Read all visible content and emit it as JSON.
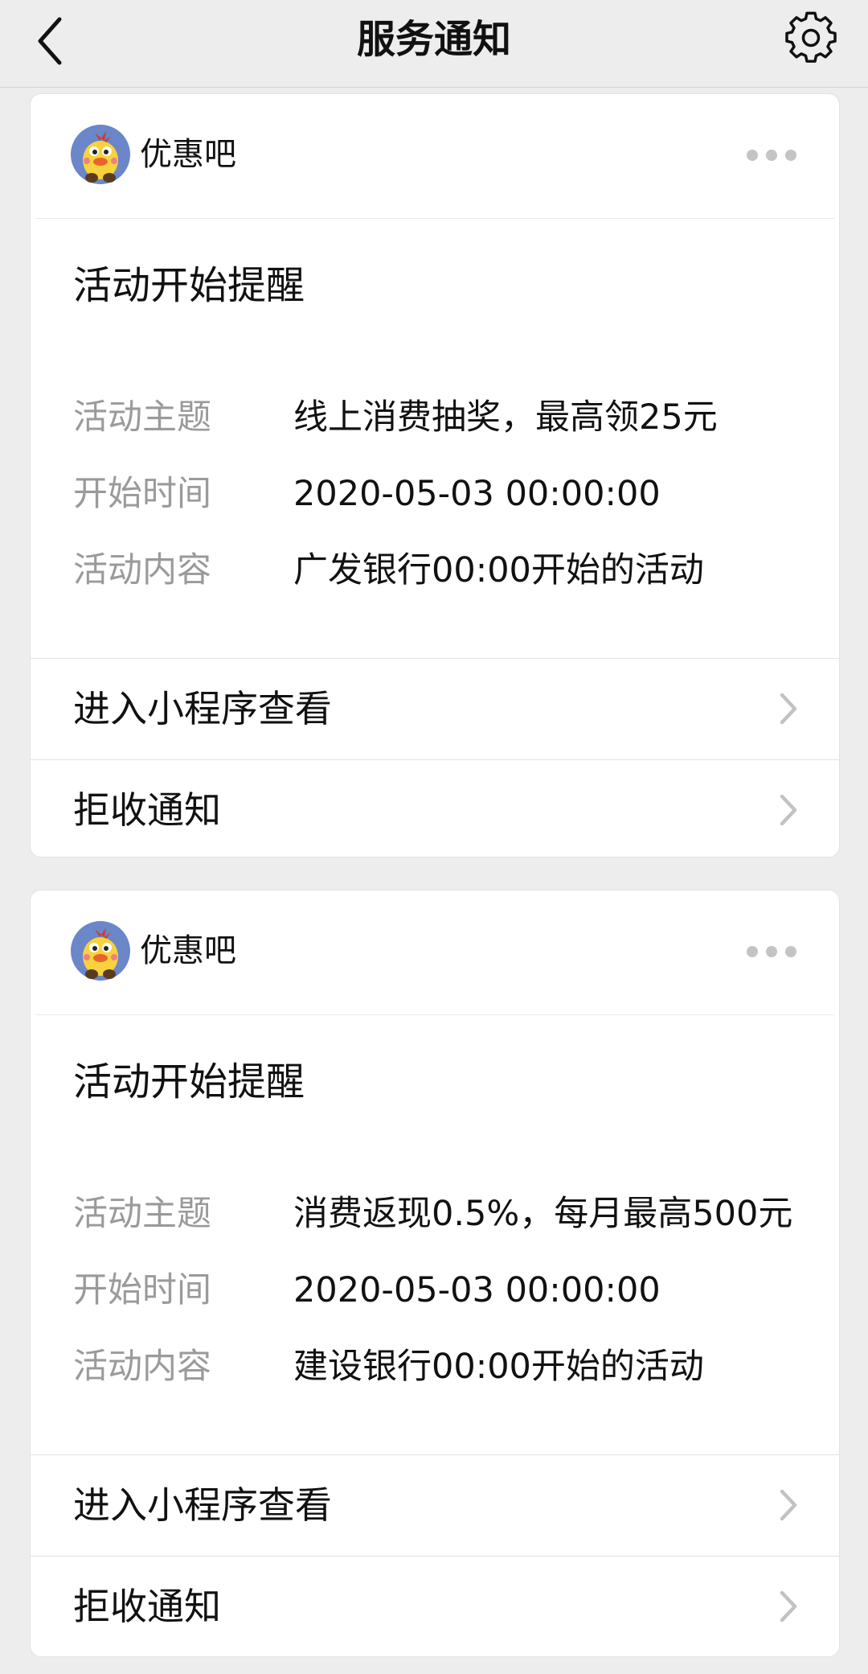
{
  "navbar": {
    "title": "服务通知",
    "back_icon": "chevron-left-icon",
    "settings_icon": "gear-icon"
  },
  "notifications": [
    {
      "sender": "优惠吧",
      "title": "活动开始提醒",
      "fields": [
        {
          "label": "活动主题",
          "value": "线上消费抽奖，最高领25元"
        },
        {
          "label": "开始时间",
          "value": "2020-05-03 00:00:00"
        },
        {
          "label": "活动内容",
          "value": "广发银行00:00开始的活动"
        }
      ],
      "actions": [
        {
          "label": "进入小程序查看"
        },
        {
          "label": "拒收通知"
        }
      ]
    },
    {
      "sender": "优惠吧",
      "title": "活动开始提醒",
      "fields": [
        {
          "label": "活动主题",
          "value": "消费返现0.5%，每月最高500元"
        },
        {
          "label": "开始时间",
          "value": "2020-05-03 00:00:00"
        },
        {
          "label": "活动内容",
          "value": "建设银行00:00开始的活动"
        }
      ],
      "actions": [
        {
          "label": "进入小程序查看"
        },
        {
          "label": "拒收通知"
        }
      ]
    }
  ],
  "colors": {
    "background": "#ededed",
    "card": "#ffffff",
    "label_gray": "#9a9a9a",
    "avatar_blue": "#6b86c9",
    "avatar_yellow": "#f7d23c"
  }
}
